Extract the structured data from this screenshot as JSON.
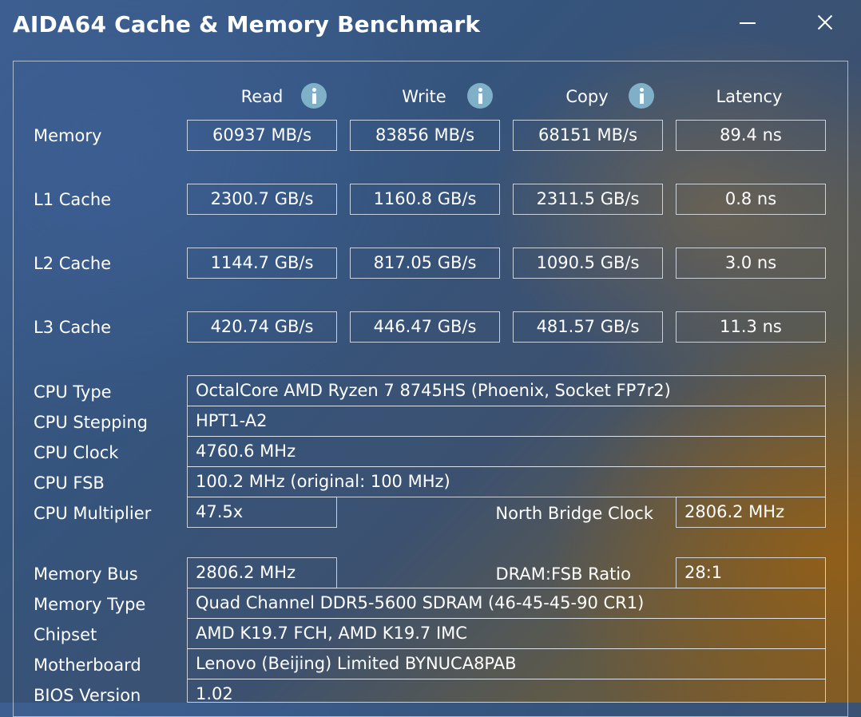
{
  "window": {
    "title": "AIDA64 Cache & Memory Benchmark"
  },
  "headers": {
    "read": "Read",
    "write": "Write",
    "copy": "Copy",
    "latency": "Latency"
  },
  "bench": [
    {
      "label": "Memory",
      "read": "60937 MB/s",
      "write": "83856 MB/s",
      "copy": "68151 MB/s",
      "latency": "89.4 ns"
    },
    {
      "label": "L1 Cache",
      "read": "2300.7 GB/s",
      "write": "1160.8 GB/s",
      "copy": "2311.5 GB/s",
      "latency": "0.8 ns"
    },
    {
      "label": "L2 Cache",
      "read": "1144.7 GB/s",
      "write": "817.05 GB/s",
      "copy": "1090.5 GB/s",
      "latency": "3.0 ns"
    },
    {
      "label": "L3 Cache",
      "read": "420.74 GB/s",
      "write": "446.47 GB/s",
      "copy": "481.57 GB/s",
      "latency": "11.3 ns"
    }
  ],
  "cpu": {
    "type": {
      "label": "CPU Type",
      "value": "OctalCore AMD Ryzen 7 8745HS  (Phoenix, Socket FP7r2)"
    },
    "stepping": {
      "label": "CPU Stepping",
      "value": "HPT1-A2"
    },
    "clock": {
      "label": "CPU Clock",
      "value": "4760.6 MHz"
    },
    "fsb": {
      "label": "CPU FSB",
      "value": "100.2 MHz  (original: 100 MHz)"
    },
    "multiplier": {
      "label": "CPU Multiplier",
      "value": "47.5x"
    },
    "nb_clock": {
      "label": "North Bridge Clock",
      "value": "2806.2 MHz"
    }
  },
  "memory": {
    "bus": {
      "label": "Memory Bus",
      "value": "2806.2 MHz"
    },
    "dram_ratio": {
      "label": "DRAM:FSB Ratio",
      "value": "28:1"
    },
    "type": {
      "label": "Memory Type",
      "value": "Quad Channel DDR5-5600 SDRAM  (46-45-45-90 CR1)"
    },
    "chipset": {
      "label": "Chipset",
      "value": "AMD K19.7 FCH, AMD K19.7 IMC"
    },
    "motherboard": {
      "label": "Motherboard",
      "value": "Lenovo (Beijing) Limited BYNUCA8PAB"
    },
    "bios": {
      "label": "BIOS Version",
      "value": "1.02"
    }
  },
  "icons": {
    "minimize": "minimize-icon",
    "close": "close-icon",
    "info": "info-icon"
  }
}
